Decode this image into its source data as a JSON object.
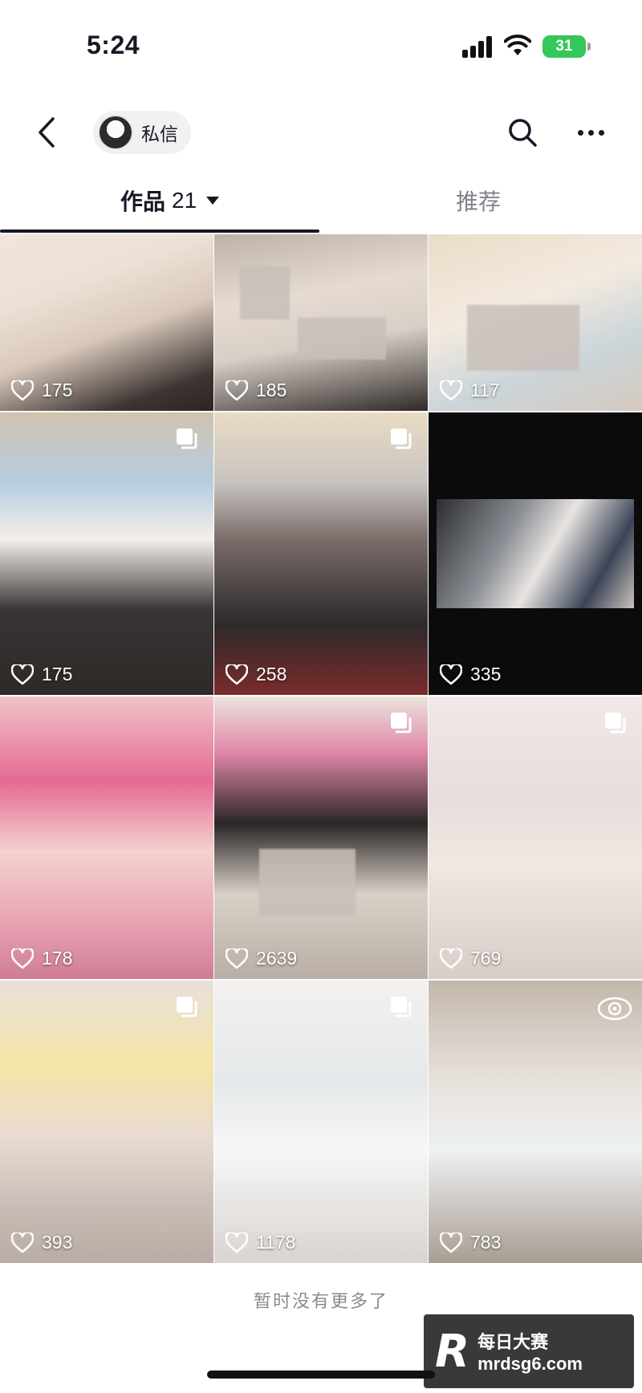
{
  "status_bar": {
    "time": "5:24",
    "battery": "31"
  },
  "nav": {
    "private_message_label": "私信"
  },
  "tabs": {
    "works_label": "作品",
    "works_count": "21",
    "recommended_label": "推荐"
  },
  "grid": {
    "tiles": [
      {
        "likes": "175",
        "multi": false
      },
      {
        "likes": "185",
        "multi": false
      },
      {
        "likes": "117",
        "multi": false
      },
      {
        "likes": "175",
        "multi": true
      },
      {
        "likes": "258",
        "multi": true
      },
      {
        "likes": "335",
        "multi": false
      },
      {
        "likes": "178",
        "multi": false
      },
      {
        "likes": "2639",
        "multi": true
      },
      {
        "likes": "769",
        "multi": true
      },
      {
        "likes": "393",
        "multi": true
      },
      {
        "likes": "1178",
        "multi": true
      },
      {
        "likes": "783",
        "multi": false,
        "panorama": true
      }
    ]
  },
  "footer": {
    "no_more_text": "暂时没有更多了"
  },
  "watermark": {
    "letter": "R",
    "line1": "每日大赛",
    "line2": "mrdsg6.com"
  },
  "colors": {
    "text_primary": "#161823",
    "text_secondary": "#808289",
    "battery_green": "#34c759"
  }
}
